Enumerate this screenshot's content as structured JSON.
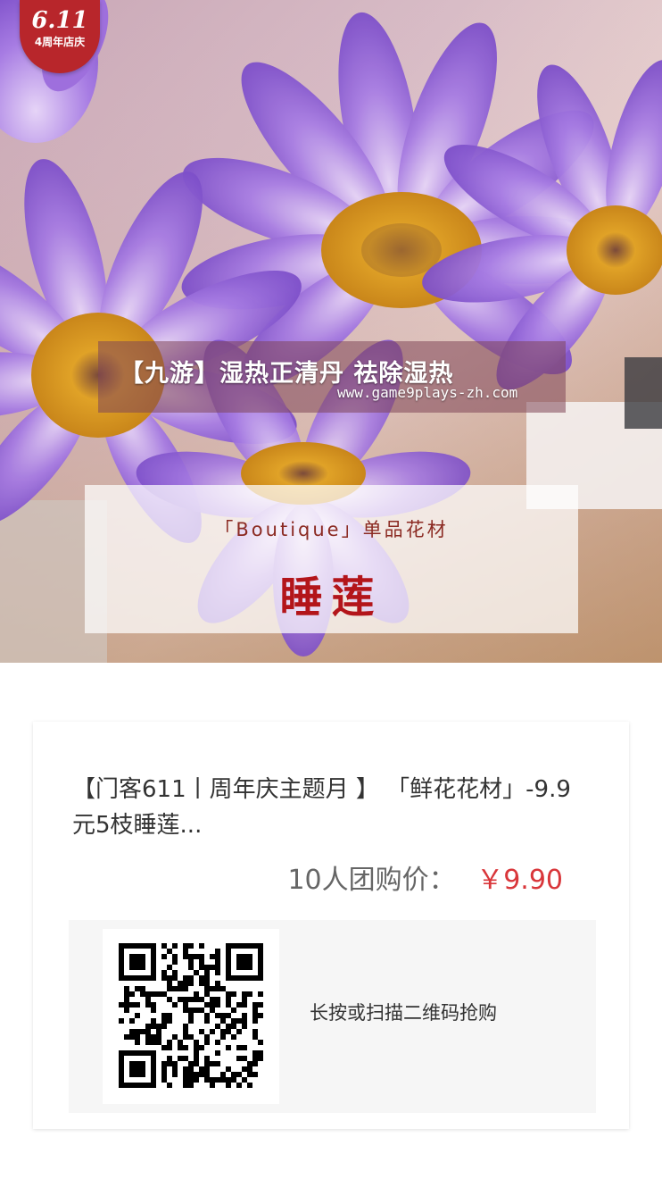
{
  "hero": {
    "badge_date": "6.11",
    "badge_text": "4周年店庆",
    "overlay_title": "【九游】湿热正清丹 祛除湿热",
    "overlay_url": "www.game9plays-zh.com",
    "boutique_subtitle": "「Boutique」单品花材",
    "boutique_title": "睡莲"
  },
  "product": {
    "title": "【门客611丨周年庆主题月 】 「鲜花花材」-9.9元5枝睡莲...",
    "price_label": "10人团购价：",
    "price_value": "￥9.90",
    "qr_hint": "长按或扫描二维码抢购"
  },
  "colors": {
    "price": "#d9363a",
    "badge": "#b8262b",
    "boutique_title": "#b3151a"
  },
  "icons": {
    "qr": "qr-code-icon"
  }
}
